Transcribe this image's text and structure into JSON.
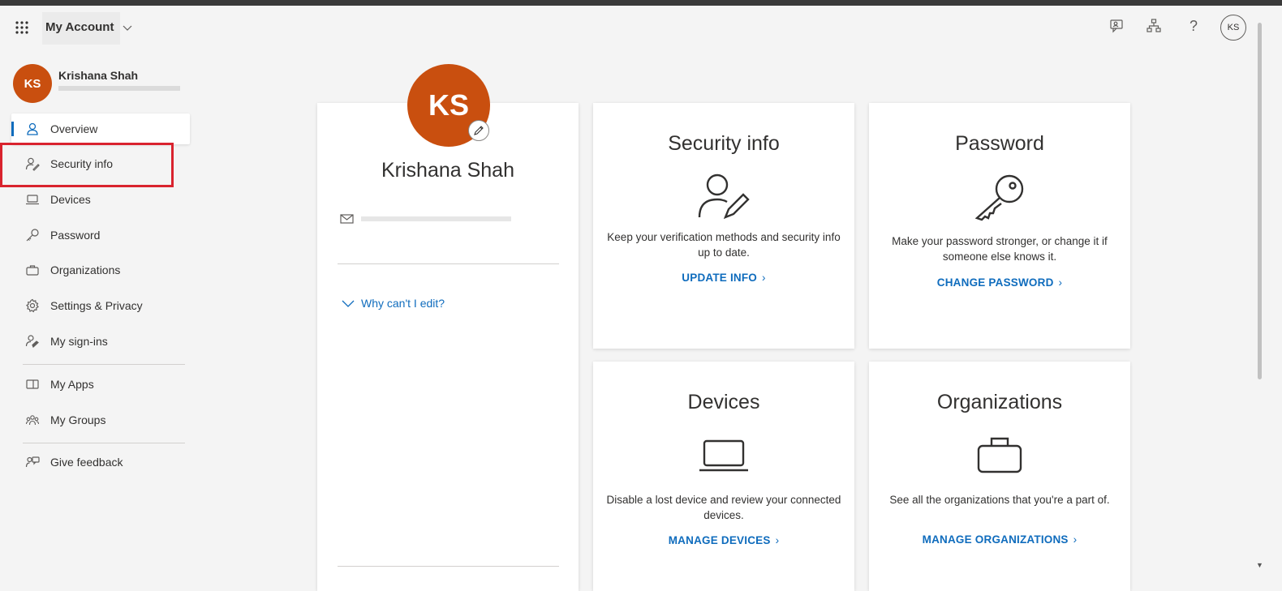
{
  "header": {
    "app_title": "My Account",
    "help_label": "?",
    "avatar_initials": "KS"
  },
  "user": {
    "initials": "KS",
    "name": "Krishana Shah"
  },
  "sidebar": {
    "items": [
      {
        "label": "Overview",
        "icon": "person-icon"
      },
      {
        "label": "Security info",
        "icon": "security-info-icon"
      },
      {
        "label": "Devices",
        "icon": "laptop-icon"
      },
      {
        "label": "Password",
        "icon": "key-icon"
      },
      {
        "label": "Organizations",
        "icon": "briefcase-icon"
      },
      {
        "label": "Settings & Privacy",
        "icon": "gear-icon"
      },
      {
        "label": "My sign-ins",
        "icon": "sign-ins-icon"
      },
      {
        "label": "My Apps",
        "icon": "apps-icon"
      },
      {
        "label": "My Groups",
        "icon": "groups-icon"
      },
      {
        "label": "Give feedback",
        "icon": "feedback-icon"
      }
    ]
  },
  "profile": {
    "initials": "KS",
    "name": "Krishana Shah",
    "why_cant_edit": "Why can't I edit?"
  },
  "tiles": {
    "security_info": {
      "title": "Security info",
      "description": "Keep your verification methods and security info up to date.",
      "link": "UPDATE INFO"
    },
    "password": {
      "title": "Password",
      "description": "Make your password stronger, or change it if someone else knows it.",
      "link": "CHANGE PASSWORD"
    },
    "devices": {
      "title": "Devices",
      "description": "Disable a lost device and review your connected devices.",
      "link": "MANAGE DEVICES"
    },
    "organizations": {
      "title": "Organizations",
      "description": "See all the organizations that you're a part of.",
      "link": "MANAGE ORGANIZATIONS"
    }
  },
  "colors": {
    "accent": "#0f6cbd",
    "avatar": "#c94f0f",
    "highlight": "#d9232e"
  }
}
